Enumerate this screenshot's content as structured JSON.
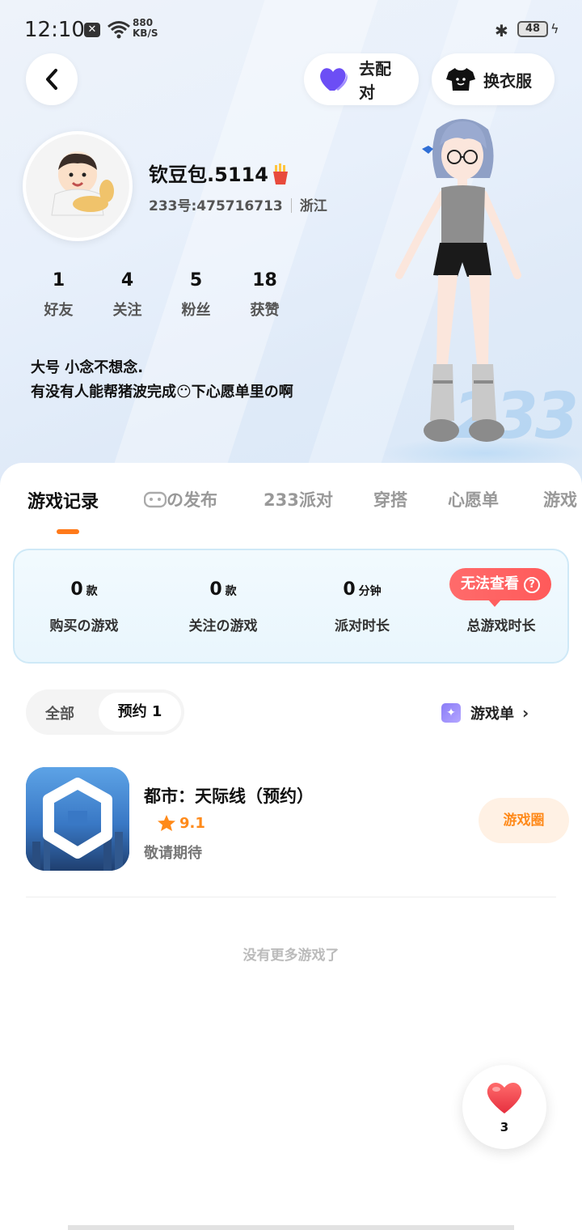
{
  "status_bar": {
    "time": "12:10",
    "speed_value": "880",
    "speed_unit": "KB/S",
    "battery": "48"
  },
  "header": {
    "match_label": "去配对",
    "dress_label": "换衣服"
  },
  "profile": {
    "nickname": "钦豆包.5114",
    "uid": "233号:475716713",
    "region": "浙江",
    "stats": [
      {
        "value": "1",
        "label": "好友"
      },
      {
        "value": "4",
        "label": "关注"
      },
      {
        "value": "5",
        "label": "粉丝"
      },
      {
        "value": "18",
        "label": "获赞"
      }
    ],
    "bio_line1": "大号 小念不想念.",
    "bio_line2": "有没有人能帮猪波完成😶下心愿单里の啊",
    "bg_mark": "233"
  },
  "tabs": [
    {
      "label": "游戏记录",
      "active": true
    },
    {
      "label": "の发布",
      "active": false
    },
    {
      "label": "233派对",
      "active": false
    },
    {
      "label": "穿搭",
      "active": false
    },
    {
      "label": "心愿单",
      "active": false
    },
    {
      "label": "游戏",
      "active": false
    }
  ],
  "summary": {
    "items": [
      {
        "value": "0",
        "unit": "款",
        "label": "购买の游戏"
      },
      {
        "value": "0",
        "unit": "款",
        "label": "关注の游戏"
      },
      {
        "value": "0",
        "unit": "分钟",
        "label": "派对时长"
      },
      {
        "value": "",
        "unit": "",
        "label": "总游戏时长"
      }
    ],
    "cannot_view": "无法查看",
    "help_glyph": "?"
  },
  "filter": {
    "all_label": "全部",
    "selected_label": "预约 1",
    "game_list_label": "游戏单"
  },
  "games": [
    {
      "title": "都市：天际线（预约）",
      "rating": "9.1",
      "status": "敬请期待",
      "action": "游戏圈"
    }
  ],
  "footer": {
    "no_more": "没有更多游戏了"
  },
  "like_fab": {
    "count": "3"
  },
  "colors": {
    "accent_orange": "#ff7a1a",
    "badge_red": "#ff5e5e",
    "heart_purple": "#7b5cff"
  }
}
